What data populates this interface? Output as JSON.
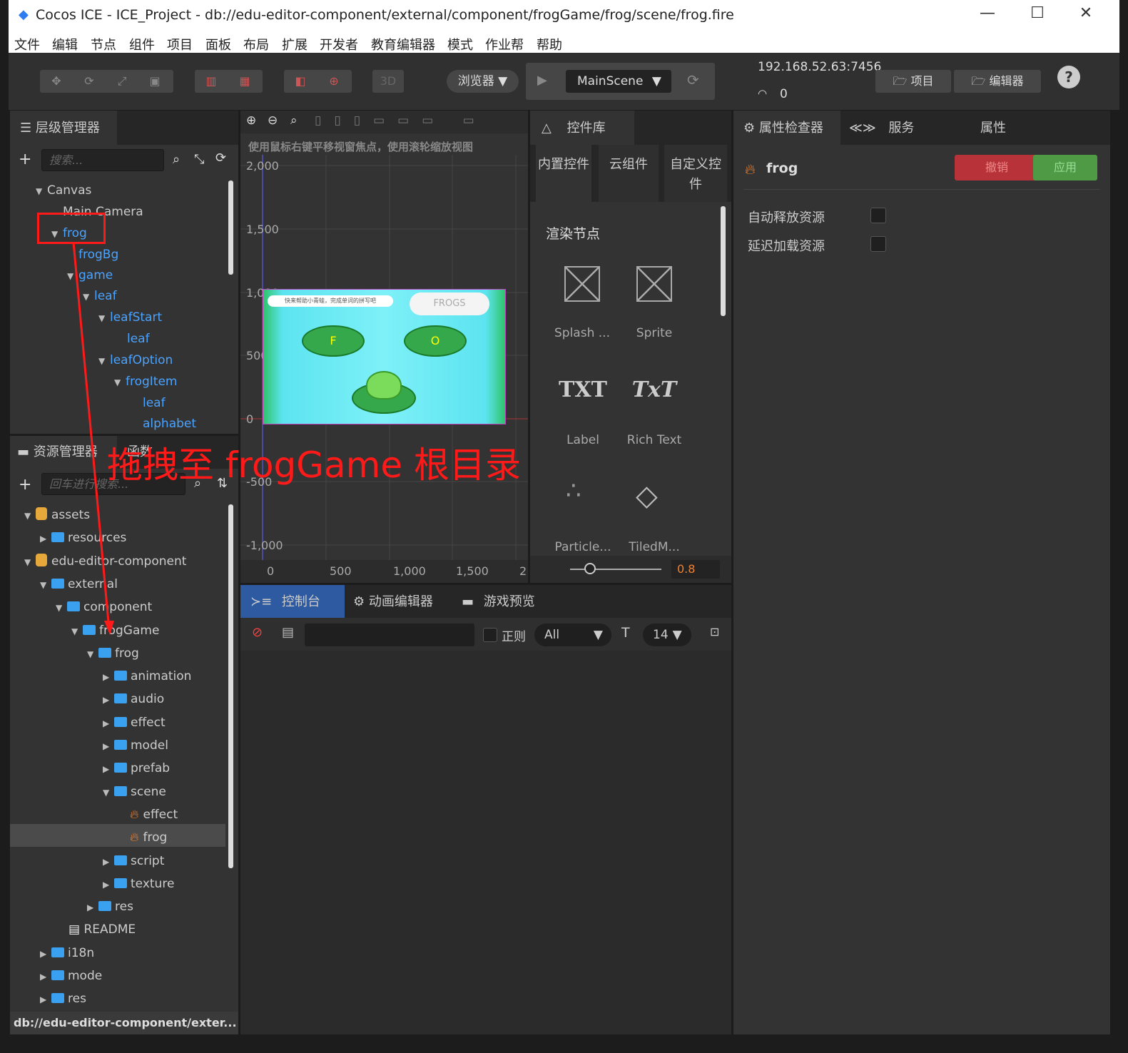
{
  "window": {
    "title": "Cocos ICE - ICE_Project - db://edu-editor-component/external/component/frogGame/frog/scene/frog.fire",
    "minimize": "—",
    "maximize": "☐",
    "close": "✕"
  },
  "menu": [
    "文件",
    "编辑",
    "节点",
    "组件",
    "项目",
    "面板",
    "布局",
    "扩展",
    "开发者",
    "教育编辑器",
    "模式",
    "作业帮",
    "帮助"
  ],
  "toolbar": {
    "tool_3d": "3D",
    "browser": "浏览器 ▼",
    "scene": "MainScene",
    "ip": "192.168.52.63:7456",
    "wifi_count": "0",
    "project": "项目",
    "editor": "编辑器",
    "help": "?"
  },
  "hierarchy": {
    "title": "层级管理器",
    "search_placeholder": "搜索...",
    "nodes": [
      {
        "label": "Canvas",
        "expanded": true,
        "blue": false
      },
      {
        "label": "Main Camera",
        "blue": false
      },
      {
        "label": "frog",
        "expanded": true,
        "blue": true
      },
      {
        "label": "frogBg",
        "blue": true
      },
      {
        "label": "game",
        "expanded": true,
        "blue": true
      },
      {
        "label": "leaf",
        "expanded": true,
        "blue": true
      },
      {
        "label": "leafStart",
        "expanded": true,
        "blue": true
      },
      {
        "label": "leaf",
        "blue": true
      },
      {
        "label": "leafOption",
        "expanded": true,
        "blue": true
      },
      {
        "label": "frogItem",
        "expanded": true,
        "blue": true
      },
      {
        "label": "leaf",
        "blue": true
      },
      {
        "label": "alphabet",
        "blue": true
      }
    ]
  },
  "assets": {
    "title": "资源管理器",
    "tab2": "函数",
    "search_placeholder": "回车进行搜索...",
    "items": [
      {
        "label": "assets",
        "icon": "asset-db",
        "arrow": "▼"
      },
      {
        "label": "resources",
        "icon": "folder",
        "arrow": "▶"
      },
      {
        "label": "edu-editor-component",
        "icon": "asset-db",
        "arrow": "▼"
      },
      {
        "label": "external",
        "icon": "folder",
        "arrow": "▼"
      },
      {
        "label": "component",
        "icon": "folder",
        "arrow": "▼"
      },
      {
        "label": "frogGame",
        "icon": "folder",
        "arrow": "▼"
      },
      {
        "label": "frog",
        "icon": "folder",
        "arrow": "▼"
      },
      {
        "label": "animation",
        "icon": "folder",
        "arrow": "▶"
      },
      {
        "label": "audio",
        "icon": "folder",
        "arrow": "▶"
      },
      {
        "label": "effect",
        "icon": "folder",
        "arrow": "▶"
      },
      {
        "label": "model",
        "icon": "folder",
        "arrow": "▶"
      },
      {
        "label": "prefab",
        "icon": "folder",
        "arrow": "▶"
      },
      {
        "label": "scene",
        "icon": "folder",
        "arrow": "▼"
      },
      {
        "label": "effect",
        "icon": "fire",
        "arrow": ""
      },
      {
        "label": "frog",
        "icon": "fire",
        "arrow": "",
        "selected": true
      },
      {
        "label": "script",
        "icon": "folder",
        "arrow": "▶"
      },
      {
        "label": "texture",
        "icon": "folder",
        "arrow": "▶"
      },
      {
        "label": "res",
        "icon": "folder",
        "arrow": "▶"
      },
      {
        "label": "README",
        "icon": "doc",
        "arrow": ""
      },
      {
        "label": "i18n",
        "icon": "folder",
        "arrow": "▶"
      },
      {
        "label": "mode",
        "icon": "folder",
        "arrow": "▶"
      },
      {
        "label": "res",
        "icon": "folder",
        "arrow": "▶"
      }
    ],
    "status": "db://edu-editor-component/exter..."
  },
  "scene": {
    "hint": "使用鼠标右键平移视窗焦点，使用滚轮缩放视图",
    "y_labels": [
      "2,000",
      "1,500",
      "1,000",
      "500",
      "0",
      "-500",
      "-1,000"
    ],
    "x_labels": [
      "0",
      "500",
      "1,000",
      "1,500",
      "2"
    ],
    "game": {
      "banner": "快来帮助小青蛙，完成单词的拼写吧",
      "cloud": "FROGS",
      "letters": [
        "F",
        "O"
      ]
    }
  },
  "annotation": "拖拽至 frogGame 根目录",
  "library": {
    "title": "控件库",
    "tabs": [
      "内置控件",
      "云组件",
      "自定义控件"
    ],
    "section": "渲染节点",
    "items": [
      {
        "label": "Splash ...",
        "glyph": ""
      },
      {
        "label": "Sprite",
        "glyph": ""
      },
      {
        "label": "Label",
        "glyph": "TXT"
      },
      {
        "label": "Rich Text",
        "glyph": "TxT"
      },
      {
        "label": "Particle...",
        "glyph": ""
      },
      {
        "label": "TiledM...",
        "glyph": ""
      }
    ],
    "zoom": "0.8"
  },
  "console": {
    "tabs": [
      "控制台",
      "动画编辑器",
      "游戏预览"
    ],
    "regex": "正则",
    "level": "All",
    "font_size": "14"
  },
  "inspector": {
    "tabs": [
      "属性检查器",
      "服务",
      "属性"
    ],
    "node": "frog",
    "revert": "撤销",
    "apply": "应用",
    "fields": [
      {
        "label": "自动释放资源"
      },
      {
        "label": "延迟加载资源"
      }
    ]
  },
  "colors": {
    "accent": "#4aa3ff",
    "annotation": "#ff1a1a",
    "revert": "#b8323a",
    "apply": "#4f9a44"
  }
}
